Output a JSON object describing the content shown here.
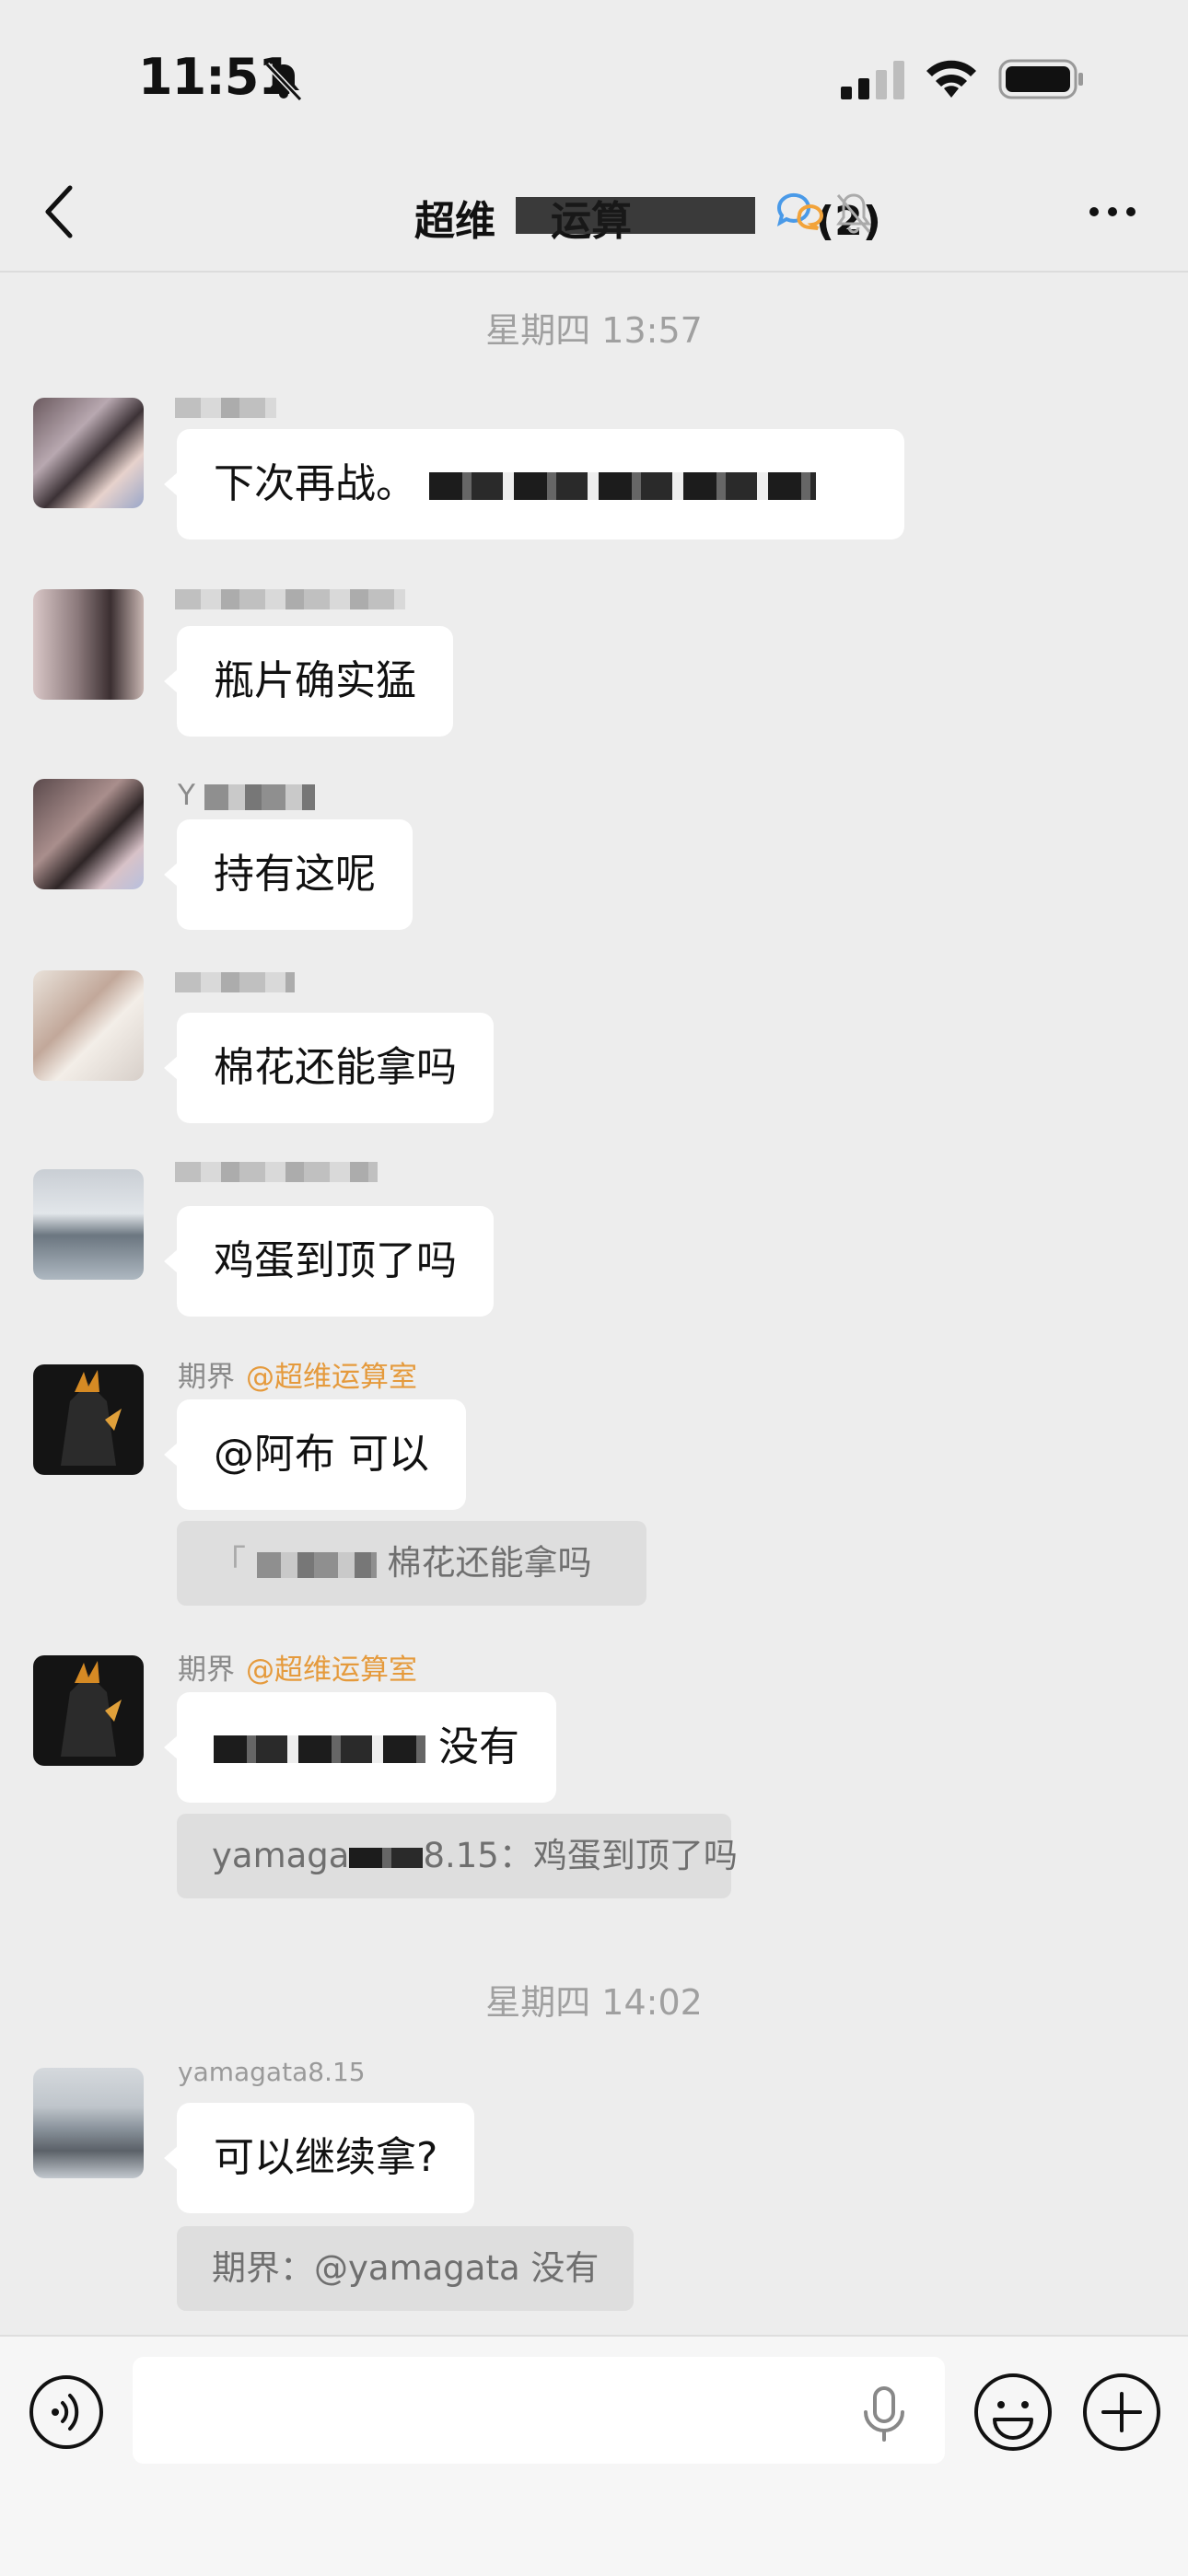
{
  "status_bar": {
    "time": "11:51"
  },
  "nav": {
    "title_start": "超维",
    "title_mid": "运算",
    "title_end": "(2)"
  },
  "chat": {
    "timestamps": [
      "星期四 13:57",
      "星期四 14:02"
    ],
    "messages": [
      {
        "text": "下次再战。"
      },
      {
        "text": "瓶片确实猛"
      },
      {
        "sender": "Y",
        "text": "持有这呢"
      },
      {
        "text": "棉花还能拿吗"
      },
      {
        "text": "鸡蛋到顶了吗"
      },
      {
        "sender": "期界",
        "mention": "@超维运算室",
        "text": "@阿布 可以",
        "quote_text": "棉花还能拿吗"
      },
      {
        "sender": "期界",
        "mention": "@超维运算室",
        "text_tail": "没有",
        "quote_prefix": "yamaga",
        "quote_mid": "8.15：",
        "quote_text": "鸡蛋到顶了吗"
      },
      {
        "sender": "yamagata8.15",
        "text": "可以继续拿?",
        "quote": "期界：@yamagata 没有"
      }
    ]
  },
  "input": {
    "placeholder": ""
  }
}
